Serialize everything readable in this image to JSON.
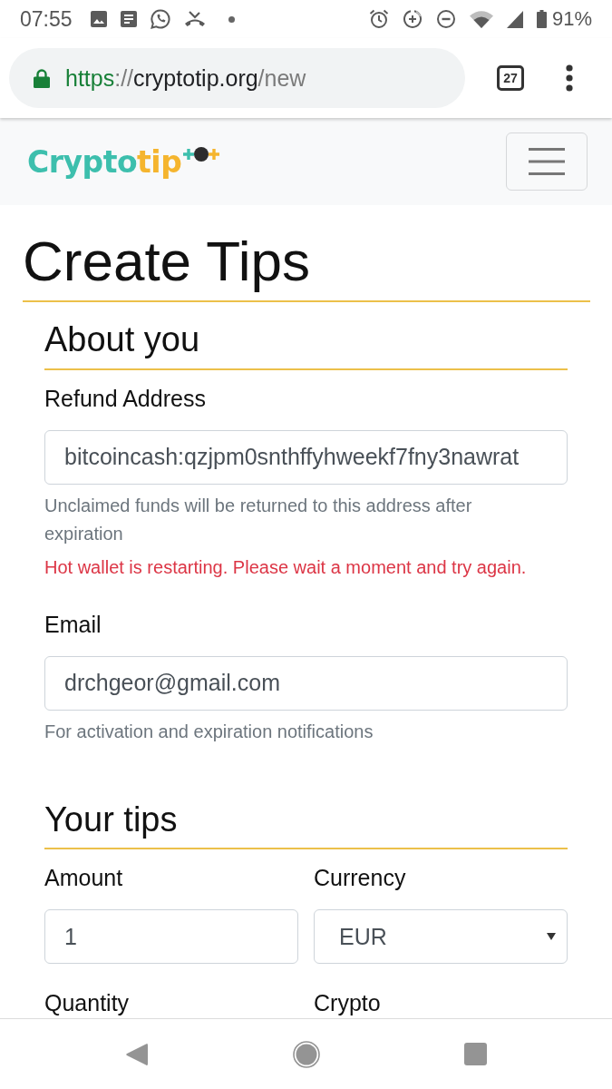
{
  "status_bar": {
    "time": "07:55",
    "battery": "91%"
  },
  "browser": {
    "url": [
      {
        "text": "https",
        "kind": "scheme"
      },
      {
        "text": "://",
        "kind": "separator"
      },
      {
        "text": "cryptotip.org",
        "kind": "host"
      },
      {
        "text": "/new",
        "kind": "path"
      }
    ],
    "tab_count": "27"
  },
  "navbar": {
    "logo": [
      {
        "text": "Crypto",
        "kind": "primary"
      },
      {
        "text": "tip",
        "kind": "accent"
      }
    ]
  },
  "title": "Create Tips",
  "sections": [
    {
      "heading": "About you",
      "rows": [
        [
          {
            "label": "Refund Address",
            "input": {
              "kind": "text",
              "value": "bitcoincash:qzjpm0snthffyhweekf7fny3nawrat"
            },
            "notes": [
              {
                "kind": "help",
                "text": "Unclaimed funds will be returned to this address after expiration"
              },
              {
                "kind": "error",
                "text": "Hot wallet is restarting. Please wait a moment and try again."
              }
            ]
          }
        ],
        [
          {
            "label": "Email",
            "input": {
              "kind": "text",
              "value": "drchgeor@gmail.com"
            },
            "notes": [
              {
                "kind": "help",
                "text": "For activation and expiration notifications"
              }
            ]
          }
        ]
      ]
    },
    {
      "heading": "Your tips",
      "rows": [
        [
          {
            "label": "Amount",
            "input": {
              "kind": "text",
              "value": "1"
            }
          },
          {
            "label": "Currency",
            "input": {
              "kind": "select",
              "value": "EUR"
            }
          }
        ],
        [
          {
            "label": "Quantity"
          },
          {
            "label": "Crypto"
          }
        ]
      ]
    }
  ]
}
